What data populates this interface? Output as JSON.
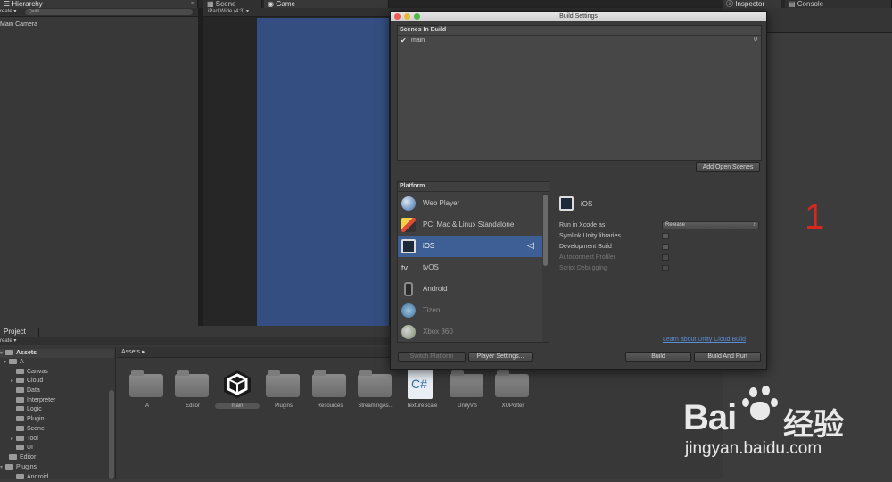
{
  "colors": {
    "accent": "#3e5f96",
    "game_view": "#344e82",
    "red_number": "#d8281e"
  },
  "top_tabs": {
    "hierarchy": "Hierarchy",
    "scene": "Scene",
    "game": "Game",
    "inspector": "Inspector",
    "console": "Console"
  },
  "hierarchy": {
    "create_label": "reate ▾",
    "search_placeholder": "Q▾All",
    "items": [
      "Main Camera"
    ]
  },
  "game_view": {
    "aspect": "iPad Wide (4:3)"
  },
  "project": {
    "tab": "Project",
    "create_label": "reate ▾",
    "breadcrumb": "Assets ▸",
    "tree": [
      {
        "label": "Assets",
        "bold": true
      },
      {
        "label": "A"
      },
      {
        "label": "Canvas"
      },
      {
        "label": "Cloud"
      },
      {
        "label": "Data"
      },
      {
        "label": "Interpreter"
      },
      {
        "label": "Logic"
      },
      {
        "label": "Plugin"
      },
      {
        "label": "Scene"
      },
      {
        "label": "Tool"
      },
      {
        "label": "UI"
      },
      {
        "label": "Editor"
      },
      {
        "label": "Plugins"
      },
      {
        "label": "Android"
      }
    ],
    "assets": [
      {
        "label": "A",
        "icon": "folder-icon"
      },
      {
        "label": "Editor",
        "icon": "folder-icon"
      },
      {
        "label": "main",
        "icon": "unity-scene-icon"
      },
      {
        "label": "Plugins",
        "icon": "folder-icon"
      },
      {
        "label": "Resources",
        "icon": "folder-icon"
      },
      {
        "label": "StreamingAs...",
        "icon": "folder-icon"
      },
      {
        "label": "TextureScale",
        "icon": "csharp-script-icon"
      },
      {
        "label": "UnityVS",
        "icon": "folder-icon"
      },
      {
        "label": "XUPorter",
        "icon": "folder-icon"
      }
    ]
  },
  "build": {
    "title": "Build Settings",
    "scenes_header": "Scenes In Build",
    "scene_name": "main",
    "scene_index": "0",
    "add_open_scenes": "Add Open Scenes",
    "platform_header": "Platform",
    "platforms": [
      {
        "label": "Web Player",
        "icon": "web-player-icon"
      },
      {
        "label": "PC, Mac & Linux Standalone",
        "icon": "standalone-icon"
      },
      {
        "label": "iOS",
        "icon": "ios-icon"
      },
      {
        "label": "tvOS",
        "icon": "tvos-icon"
      },
      {
        "label": "Android",
        "icon": "android-icon"
      },
      {
        "label": "Tizen",
        "icon": "tizen-icon"
      },
      {
        "label": "Xbox 360",
        "icon": "xbox-icon"
      }
    ],
    "selected_platform": "iOS",
    "tv_text": "tv",
    "options": {
      "run_in_xcode_as": "Run in Xcode as",
      "run_in_xcode_value": "Release",
      "symlink": "Symlink Unity libraries",
      "development_build": "Development Build",
      "autoconnect": "Autoconnect Profiler",
      "script_debugging": "Script Debugging"
    },
    "cloud_link": "Learn about Unity Cloud Build",
    "switch_platform": "Switch Platform",
    "player_settings": "Player Settings...",
    "build": "Build",
    "build_and_run": "Build And Run"
  },
  "annotation": "1",
  "watermark": {
    "brand": "Bai",
    "brand2": "经验",
    "url": "jingyan.baidu.com"
  }
}
